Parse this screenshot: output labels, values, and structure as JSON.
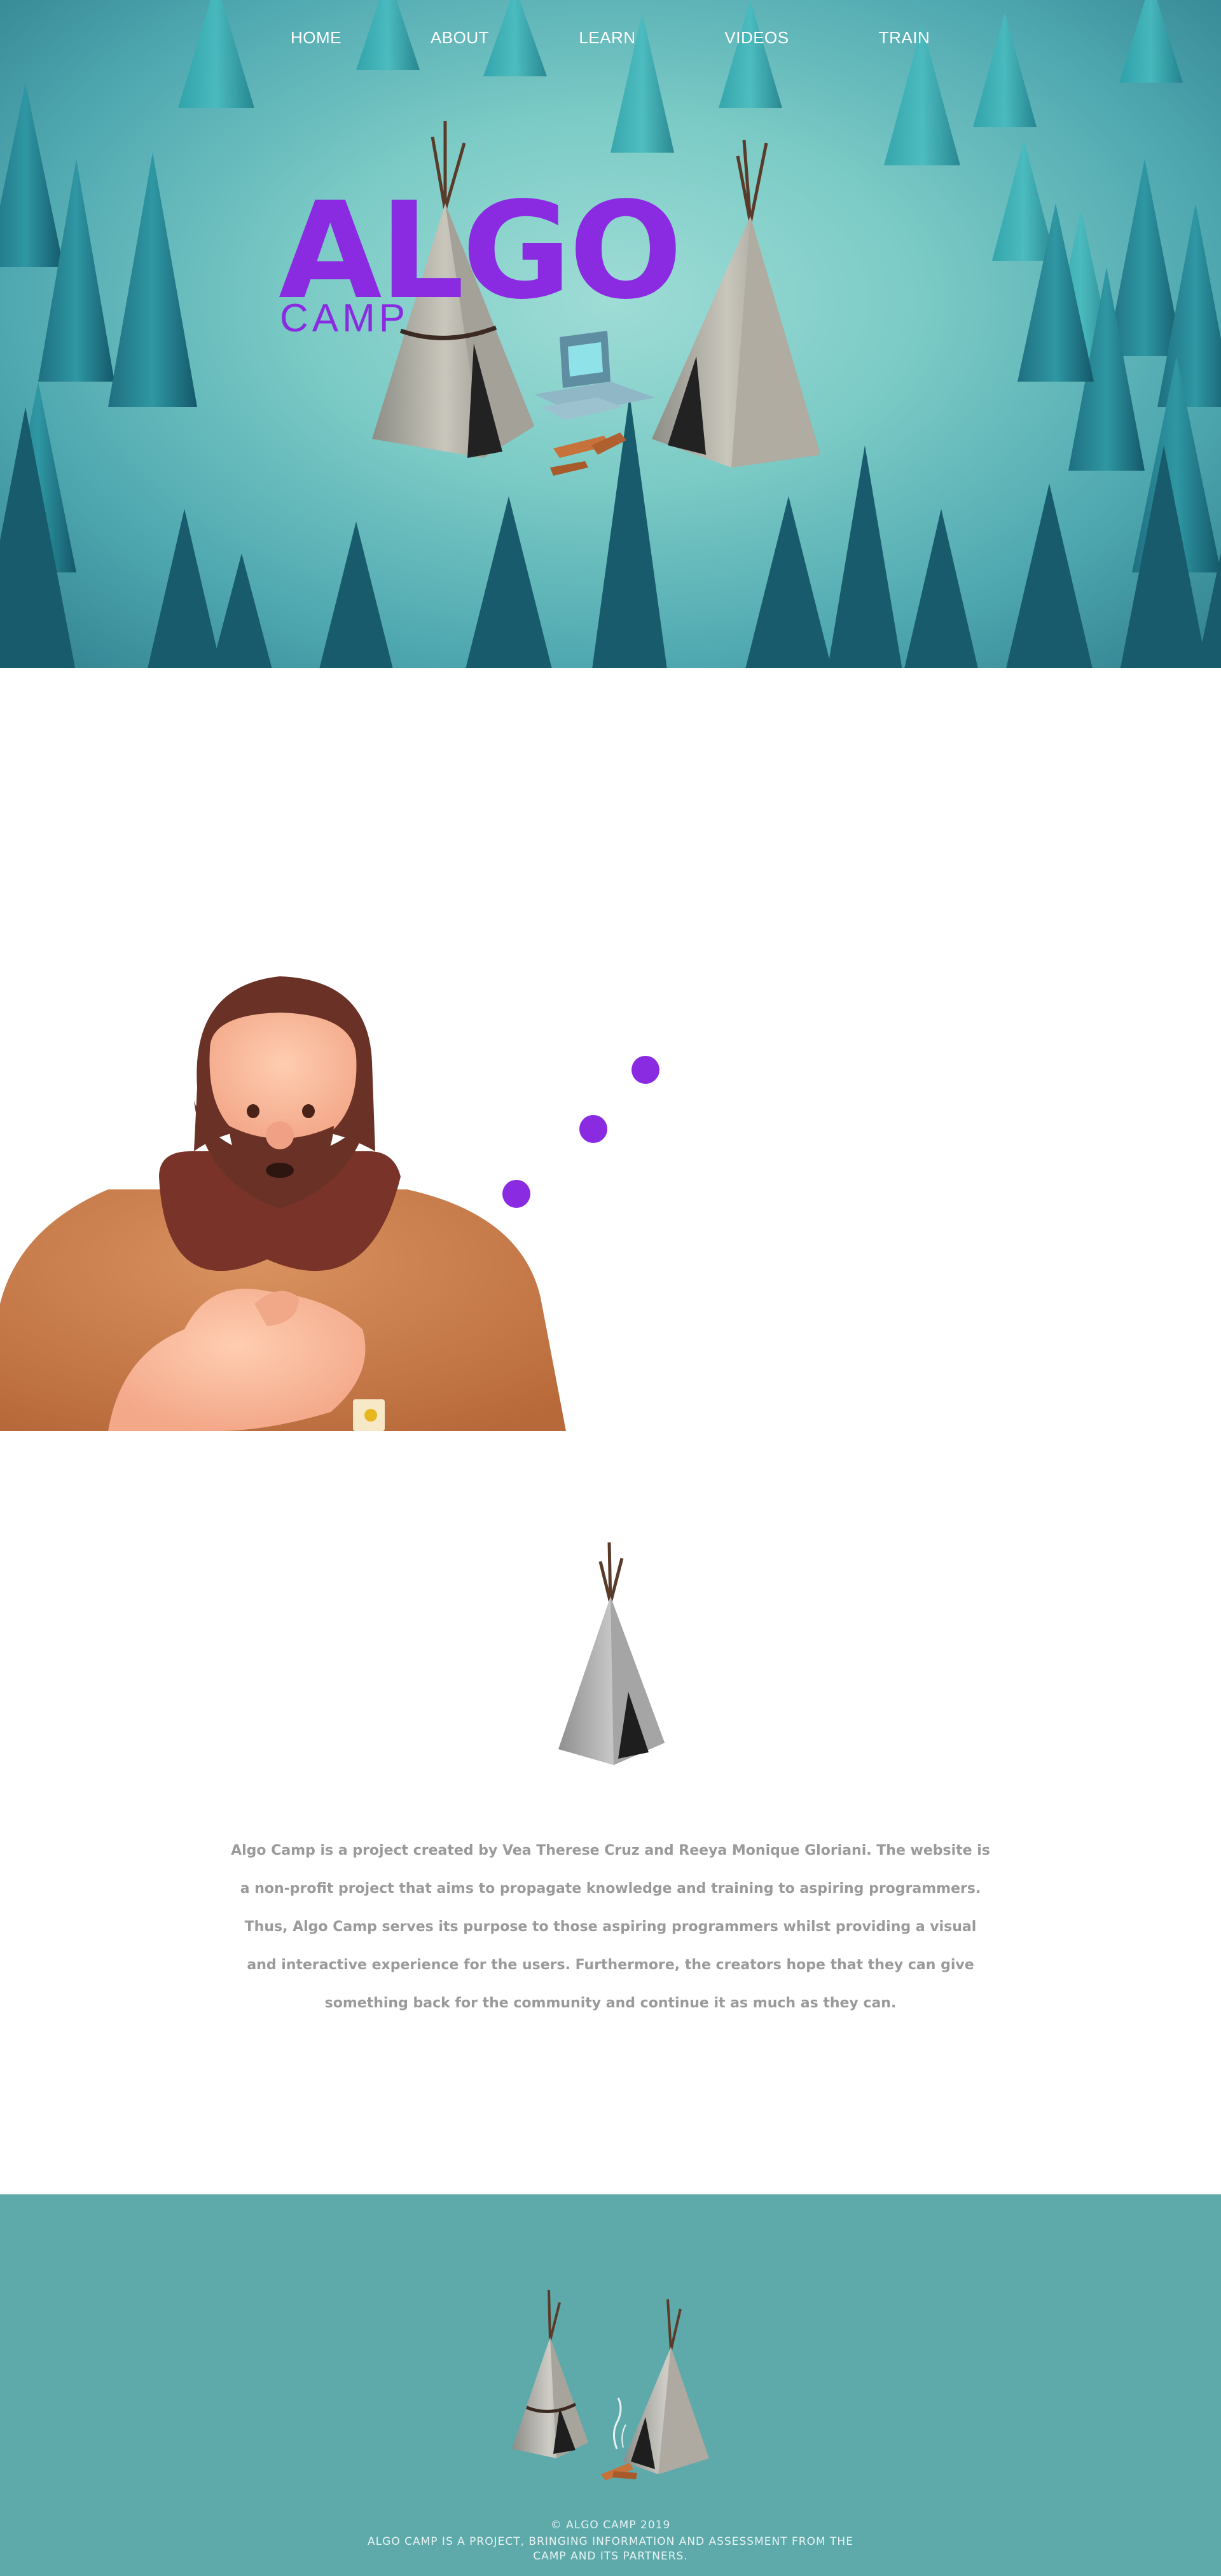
{
  "nav": {
    "items": [
      {
        "label": "HOME"
      },
      {
        "label": "ABOUT"
      },
      {
        "label": "LEARN"
      },
      {
        "label": "VIDEOS"
      },
      {
        "label": "TRAIN"
      }
    ]
  },
  "hero": {
    "logo_main": "ALGO",
    "logo_sub": "CAMP"
  },
  "about": {
    "text": "Algo Camp is a project created by Vea Therese Cruz and Reeya Monique Gloriani. The website is a non-profit project that aims to propagate knowledge and training to aspiring programmers. Thus, Algo Camp serves its purpose to those aspiring programmers whilst providing a visual and interactive experience for the users. Furthermore, the creators hope that they can give something back for the community and continue it as much as they can."
  },
  "footer": {
    "copyright": "© ALGO CAMP 2019",
    "description": "ALGO CAMP IS A PROJECT, BRINGING INFORMATION AND ASSESSMENT FROM THE CAMP AND ITS PARTNERS."
  },
  "colors": {
    "accent": "#8a2be2",
    "footer_bg": "#5eaaab",
    "body_text": "#9a9a9a"
  }
}
